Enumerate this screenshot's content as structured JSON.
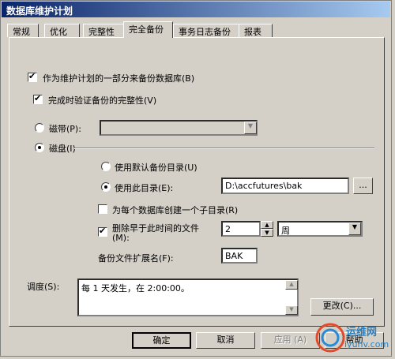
{
  "window": {
    "title": "数据库维护计划"
  },
  "tabs": [
    {
      "label": "常规"
    },
    {
      "label": "优化"
    },
    {
      "label": "完整性"
    },
    {
      "label": "完全备份"
    },
    {
      "label": "事务日志备份"
    },
    {
      "label": "报表"
    }
  ],
  "backup": {
    "as_part_label": "作为维护计划的一部分来备份数据库(B)",
    "as_part_checked": true,
    "verify_label": "完成时验证备份的完整性(V)",
    "verify_checked": true,
    "tape_label": "磁带(P):",
    "tape_selected": false,
    "disk_label": "磁盘(I)",
    "disk_selected": true,
    "default_dir_label": "使用默认备份目录(U)",
    "default_dir_selected": false,
    "this_dir_label": "使用此目录(E):",
    "this_dir_selected": true,
    "directory_value": "D:\\accfutures\\bak",
    "browse_label": "...",
    "subdir_label": "为每个数据库创建一个子目录(R)",
    "subdir_checked": false,
    "delete_label": "删除早于此时间的文件",
    "delete_label_2": "(M):",
    "delete_checked": true,
    "delete_value": "2",
    "delete_unit": "周",
    "ext_label": "备份文件扩展名(F):",
    "ext_value": "BAK"
  },
  "schedule": {
    "label": "调度(S):",
    "text": "每 1 天发生，在 2:00:00。",
    "change_label": "更改(C)..."
  },
  "footer": {
    "ok": "确定",
    "cancel": "取消",
    "apply": "应用 (A)",
    "help": "帮助"
  },
  "watermark": {
    "text1": "运维网",
    "text2": "iyunv.com"
  }
}
